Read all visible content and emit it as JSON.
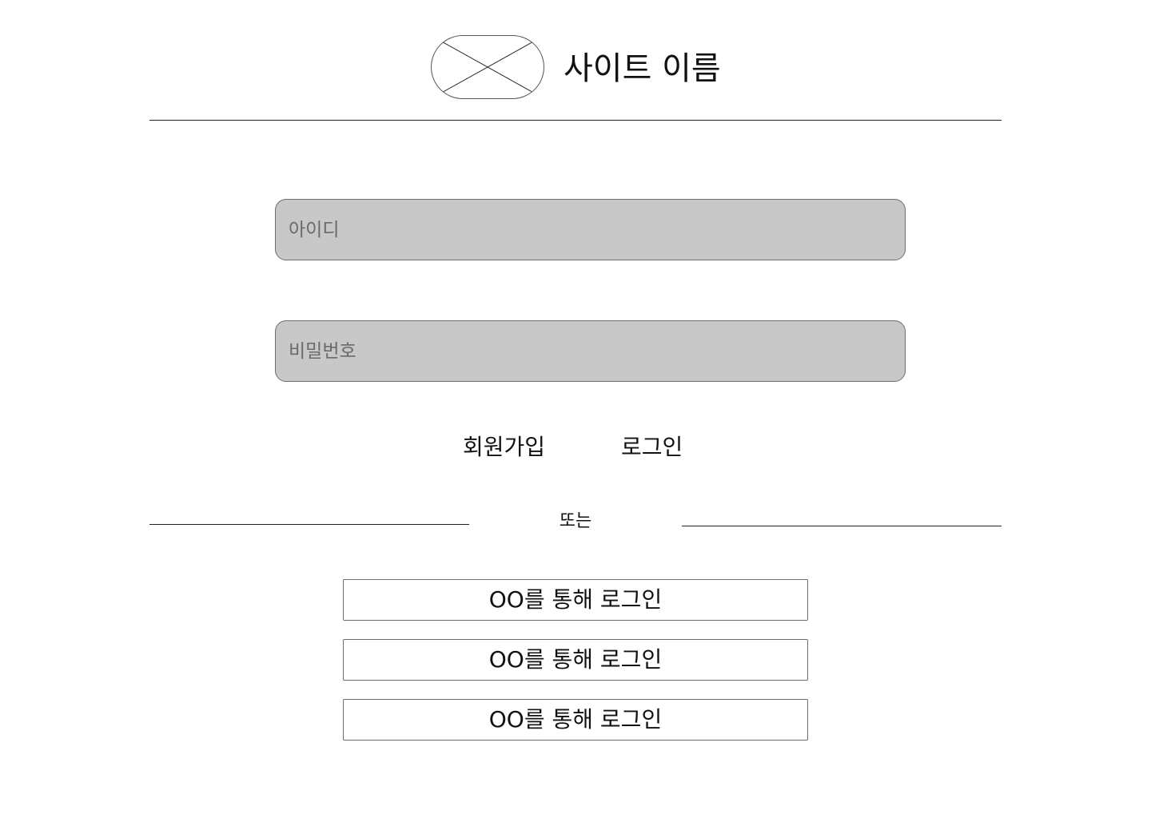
{
  "header": {
    "logo_icon": "image-placeholder-icon",
    "site_name": "사이트 이름"
  },
  "login_form": {
    "id_placeholder": "아이디",
    "password_placeholder": "비밀번호",
    "signup_label": "회원가입",
    "login_label": "로그인"
  },
  "separator": {
    "label": "또는"
  },
  "social_login": {
    "buttons": [
      {
        "label": "OO를 통해 로그인"
      },
      {
        "label": "OO를 통해 로그인"
      },
      {
        "label": "OO를 통해 로그인"
      }
    ]
  },
  "colors": {
    "input_background": "#c8c8c8",
    "border": "#6e6e6e",
    "text": "#111111",
    "background": "#ffffff"
  }
}
